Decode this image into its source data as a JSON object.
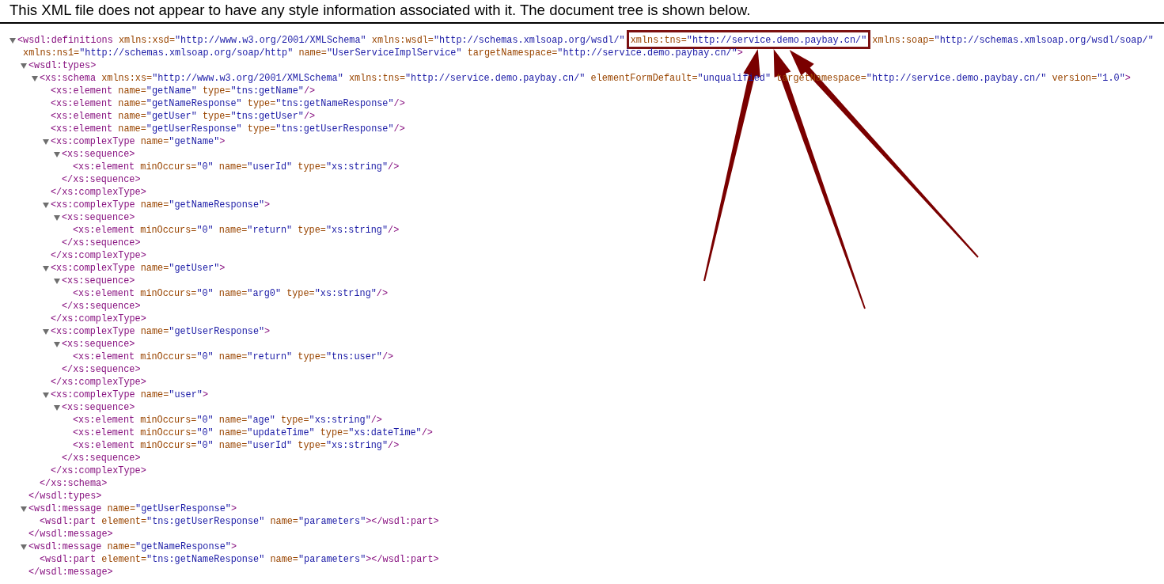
{
  "notice": "This XML file does not appear to have any style information associated with it. The document tree is shown below.",
  "tree": {
    "expanded": true,
    "open": [
      {
        "kind": "tag",
        "text": "<wsdl:definitions"
      },
      {
        "kind": "attr",
        "name": "xmlns:xsd=",
        "value": "\"http://www.w3.org/2001/XMLSchema\""
      },
      {
        "kind": "attr",
        "name": "xmlns:wsdl=",
        "value": "\"http://schemas.xmlsoap.org/wsdl/\""
      },
      {
        "kind": "attr",
        "name": "xmlns:tns=",
        "value": "\"http://service.demo.paybay.cn/\"",
        "highlighted": true
      },
      {
        "kind": "attr",
        "name": "xmlns:soap=",
        "value": "\"http://schemas.xmlsoap.org/wsdl/soap/\""
      },
      {
        "kind": "attr",
        "name": "xmlns:ns1=",
        "value": "\"http://schemas.xmlsoap.org/soap/http\""
      },
      {
        "kind": "attr",
        "name": "name=",
        "value": "\"UserServiceImplService\""
      },
      {
        "kind": "attr",
        "name": "targetNamespace=",
        "value": "\"http://service.demo.paybay.cn/\""
      },
      {
        "kind": "tag",
        "text": ">"
      }
    ],
    "children": [
      {
        "expanded": true,
        "open": [
          {
            "kind": "tag",
            "text": "<wsdl:types>"
          }
        ],
        "children": [
          {
            "expanded": true,
            "open": [
              {
                "kind": "tag",
                "text": "<xs:schema"
              },
              {
                "kind": "attr",
                "name": "xmlns:xs=",
                "value": "\"http://www.w3.org/2001/XMLSchema\""
              },
              {
                "kind": "attr",
                "name": "xmlns:tns=",
                "value": "\"http://service.demo.paybay.cn/\""
              },
              {
                "kind": "attr",
                "name": "elementFormDefault=",
                "value": "\"unqualified\""
              },
              {
                "kind": "attr",
                "name": "targetNamespace=",
                "value": "\"http://service.demo.paybay.cn/\""
              },
              {
                "kind": "attr",
                "name": "version=",
                "value": "\"1.0\""
              },
              {
                "kind": "tag",
                "text": ">"
              }
            ],
            "children": [
              {
                "line": [
                  {
                    "kind": "tag",
                    "text": "<xs:element"
                  },
                  {
                    "kind": "attr",
                    "name": "name=",
                    "value": "\"getName\""
                  },
                  {
                    "kind": "attr",
                    "name": "type=",
                    "value": "\"tns:getName\""
                  },
                  {
                    "kind": "tag",
                    "text": "/>"
                  }
                ]
              },
              {
                "line": [
                  {
                    "kind": "tag",
                    "text": "<xs:element"
                  },
                  {
                    "kind": "attr",
                    "name": "name=",
                    "value": "\"getNameResponse\""
                  },
                  {
                    "kind": "attr",
                    "name": "type=",
                    "value": "\"tns:getNameResponse\""
                  },
                  {
                    "kind": "tag",
                    "text": "/>"
                  }
                ]
              },
              {
                "line": [
                  {
                    "kind": "tag",
                    "text": "<xs:element"
                  },
                  {
                    "kind": "attr",
                    "name": "name=",
                    "value": "\"getUser\""
                  },
                  {
                    "kind": "attr",
                    "name": "type=",
                    "value": "\"tns:getUser\""
                  },
                  {
                    "kind": "tag",
                    "text": "/>"
                  }
                ]
              },
              {
                "line": [
                  {
                    "kind": "tag",
                    "text": "<xs:element"
                  },
                  {
                    "kind": "attr",
                    "name": "name=",
                    "value": "\"getUserResponse\""
                  },
                  {
                    "kind": "attr",
                    "name": "type=",
                    "value": "\"tns:getUserResponse\""
                  },
                  {
                    "kind": "tag",
                    "text": "/>"
                  }
                ]
              },
              {
                "expanded": true,
                "open": [
                  {
                    "kind": "tag",
                    "text": "<xs:complexType"
                  },
                  {
                    "kind": "attr",
                    "name": "name=",
                    "value": "\"getName\""
                  },
                  {
                    "kind": "tag",
                    "text": ">"
                  }
                ],
                "children": [
                  {
                    "expanded": true,
                    "open": [
                      {
                        "kind": "tag",
                        "text": "<xs:sequence>"
                      }
                    ],
                    "children": [
                      {
                        "line": [
                          {
                            "kind": "tag",
                            "text": "<xs:element"
                          },
                          {
                            "kind": "attr",
                            "name": "minOccurs=",
                            "value": "\"0\""
                          },
                          {
                            "kind": "attr",
                            "name": "name=",
                            "value": "\"userId\""
                          },
                          {
                            "kind": "attr",
                            "name": "type=",
                            "value": "\"xs:string\""
                          },
                          {
                            "kind": "tag",
                            "text": "/>"
                          }
                        ]
                      }
                    ],
                    "close": [
                      {
                        "kind": "tag",
                        "text": "</xs:sequence>"
                      }
                    ]
                  }
                ],
                "close": [
                  {
                    "kind": "tag",
                    "text": "</xs:complexType>"
                  }
                ]
              },
              {
                "expanded": true,
                "open": [
                  {
                    "kind": "tag",
                    "text": "<xs:complexType"
                  },
                  {
                    "kind": "attr",
                    "name": "name=",
                    "value": "\"getNameResponse\""
                  },
                  {
                    "kind": "tag",
                    "text": ">"
                  }
                ],
                "children": [
                  {
                    "expanded": true,
                    "open": [
                      {
                        "kind": "tag",
                        "text": "<xs:sequence>"
                      }
                    ],
                    "children": [
                      {
                        "line": [
                          {
                            "kind": "tag",
                            "text": "<xs:element"
                          },
                          {
                            "kind": "attr",
                            "name": "minOccurs=",
                            "value": "\"0\""
                          },
                          {
                            "kind": "attr",
                            "name": "name=",
                            "value": "\"return\""
                          },
                          {
                            "kind": "attr",
                            "name": "type=",
                            "value": "\"xs:string\""
                          },
                          {
                            "kind": "tag",
                            "text": "/>"
                          }
                        ]
                      }
                    ],
                    "close": [
                      {
                        "kind": "tag",
                        "text": "</xs:sequence>"
                      }
                    ]
                  }
                ],
                "close": [
                  {
                    "kind": "tag",
                    "text": "</xs:complexType>"
                  }
                ]
              },
              {
                "expanded": true,
                "open": [
                  {
                    "kind": "tag",
                    "text": "<xs:complexType"
                  },
                  {
                    "kind": "attr",
                    "name": "name=",
                    "value": "\"getUser\""
                  },
                  {
                    "kind": "tag",
                    "text": ">"
                  }
                ],
                "children": [
                  {
                    "expanded": true,
                    "open": [
                      {
                        "kind": "tag",
                        "text": "<xs:sequence>"
                      }
                    ],
                    "children": [
                      {
                        "line": [
                          {
                            "kind": "tag",
                            "text": "<xs:element"
                          },
                          {
                            "kind": "attr",
                            "name": "minOccurs=",
                            "value": "\"0\""
                          },
                          {
                            "kind": "attr",
                            "name": "name=",
                            "value": "\"arg0\""
                          },
                          {
                            "kind": "attr",
                            "name": "type=",
                            "value": "\"xs:string\""
                          },
                          {
                            "kind": "tag",
                            "text": "/>"
                          }
                        ]
                      }
                    ],
                    "close": [
                      {
                        "kind": "tag",
                        "text": "</xs:sequence>"
                      }
                    ]
                  }
                ],
                "close": [
                  {
                    "kind": "tag",
                    "text": "</xs:complexType>"
                  }
                ]
              },
              {
                "expanded": true,
                "open": [
                  {
                    "kind": "tag",
                    "text": "<xs:complexType"
                  },
                  {
                    "kind": "attr",
                    "name": "name=",
                    "value": "\"getUserResponse\""
                  },
                  {
                    "kind": "tag",
                    "text": ">"
                  }
                ],
                "children": [
                  {
                    "expanded": true,
                    "open": [
                      {
                        "kind": "tag",
                        "text": "<xs:sequence>"
                      }
                    ],
                    "children": [
                      {
                        "line": [
                          {
                            "kind": "tag",
                            "text": "<xs:element"
                          },
                          {
                            "kind": "attr",
                            "name": "minOccurs=",
                            "value": "\"0\""
                          },
                          {
                            "kind": "attr",
                            "name": "name=",
                            "value": "\"return\""
                          },
                          {
                            "kind": "attr",
                            "name": "type=",
                            "value": "\"tns:user\""
                          },
                          {
                            "kind": "tag",
                            "text": "/>"
                          }
                        ]
                      }
                    ],
                    "close": [
                      {
                        "kind": "tag",
                        "text": "</xs:sequence>"
                      }
                    ]
                  }
                ],
                "close": [
                  {
                    "kind": "tag",
                    "text": "</xs:complexType>"
                  }
                ]
              },
              {
                "expanded": true,
                "open": [
                  {
                    "kind": "tag",
                    "text": "<xs:complexType"
                  },
                  {
                    "kind": "attr",
                    "name": "name=",
                    "value": "\"user\""
                  },
                  {
                    "kind": "tag",
                    "text": ">"
                  }
                ],
                "children": [
                  {
                    "expanded": true,
                    "open": [
                      {
                        "kind": "tag",
                        "text": "<xs:sequence>"
                      }
                    ],
                    "children": [
                      {
                        "line": [
                          {
                            "kind": "tag",
                            "text": "<xs:element"
                          },
                          {
                            "kind": "attr",
                            "name": "minOccurs=",
                            "value": "\"0\""
                          },
                          {
                            "kind": "attr",
                            "name": "name=",
                            "value": "\"age\""
                          },
                          {
                            "kind": "attr",
                            "name": "type=",
                            "value": "\"xs:string\""
                          },
                          {
                            "kind": "tag",
                            "text": "/>"
                          }
                        ]
                      },
                      {
                        "line": [
                          {
                            "kind": "tag",
                            "text": "<xs:element"
                          },
                          {
                            "kind": "attr",
                            "name": "minOccurs=",
                            "value": "\"0\""
                          },
                          {
                            "kind": "attr",
                            "name": "name=",
                            "value": "\"updateTime\""
                          },
                          {
                            "kind": "attr",
                            "name": "type=",
                            "value": "\"xs:dateTime\""
                          },
                          {
                            "kind": "tag",
                            "text": "/>"
                          }
                        ]
                      },
                      {
                        "line": [
                          {
                            "kind": "tag",
                            "text": "<xs:element"
                          },
                          {
                            "kind": "attr",
                            "name": "minOccurs=",
                            "value": "\"0\""
                          },
                          {
                            "kind": "attr",
                            "name": "name=",
                            "value": "\"userId\""
                          },
                          {
                            "kind": "attr",
                            "name": "type=",
                            "value": "\"xs:string\""
                          },
                          {
                            "kind": "tag",
                            "text": "/>"
                          }
                        ]
                      }
                    ],
                    "close": [
                      {
                        "kind": "tag",
                        "text": "</xs:sequence>"
                      }
                    ]
                  }
                ],
                "close": [
                  {
                    "kind": "tag",
                    "text": "</xs:complexType>"
                  }
                ]
              }
            ],
            "close": [
              {
                "kind": "tag",
                "text": "</xs:schema>"
              }
            ]
          }
        ],
        "close": [
          {
            "kind": "tag",
            "text": "</wsdl:types>"
          }
        ]
      },
      {
        "expanded": true,
        "open": [
          {
            "kind": "tag",
            "text": "<wsdl:message"
          },
          {
            "kind": "attr",
            "name": "name=",
            "value": "\"getUserResponse\""
          },
          {
            "kind": "tag",
            "text": ">"
          }
        ],
        "children": [
          {
            "line": [
              {
                "kind": "tag",
                "text": "<wsdl:part"
              },
              {
                "kind": "attr",
                "name": "element=",
                "value": "\"tns:getUserResponse\""
              },
              {
                "kind": "attr",
                "name": "name=",
                "value": "\"parameters\""
              },
              {
                "kind": "tag",
                "text": "></wsdl:part>"
              }
            ]
          }
        ],
        "close": [
          {
            "kind": "tag",
            "text": "</wsdl:message>"
          }
        ]
      },
      {
        "expanded": true,
        "open": [
          {
            "kind": "tag",
            "text": "<wsdl:message"
          },
          {
            "kind": "attr",
            "name": "name=",
            "value": "\"getNameResponse\""
          },
          {
            "kind": "tag",
            "text": ">"
          }
        ],
        "children": [
          {
            "line": [
              {
                "kind": "tag",
                "text": "<wsdl:part"
              },
              {
                "kind": "attr",
                "name": "element=",
                "value": "\"tns:getNameResponse\""
              },
              {
                "kind": "attr",
                "name": "name=",
                "value": "\"parameters\""
              },
              {
                "kind": "tag",
                "text": "></wsdl:part>"
              }
            ]
          }
        ],
        "close": [
          {
            "kind": "tag",
            "text": "</wsdl:message>"
          }
        ]
      }
    ]
  }
}
